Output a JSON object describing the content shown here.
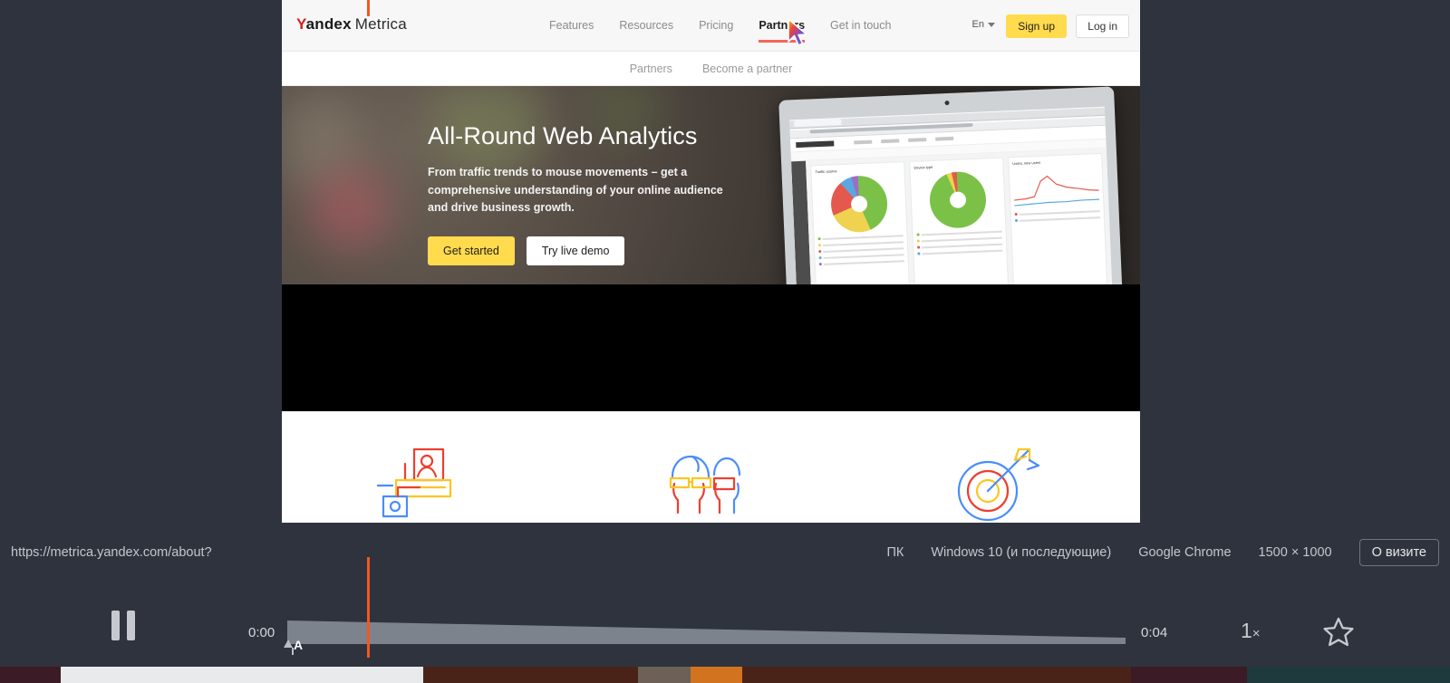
{
  "site": {
    "brand": {
      "y": "Y",
      "andex": "andex",
      "metrica": "Metrica"
    },
    "nav": [
      {
        "label": "Features",
        "active": false
      },
      {
        "label": "Resources",
        "active": false
      },
      {
        "label": "Pricing",
        "active": false
      },
      {
        "label": "Partners",
        "active": true
      },
      {
        "label": "Get in touch",
        "active": false
      }
    ],
    "lang": "En",
    "signup_label": "Sign up",
    "login_label": "Log in",
    "subnav": [
      {
        "label": "Partners"
      },
      {
        "label": "Become a partner"
      }
    ],
    "hero": {
      "title": "All-Round Web Analytics",
      "subtitle": "From traffic trends to mouse movements – get a comprehensive understanding of your online audience and drive business growth.",
      "primary_btn": "Get started",
      "secondary_btn": "Try live demo"
    },
    "dashboard": {
      "cards": [
        {
          "title": "Traffic source"
        },
        {
          "title": "Device type"
        },
        {
          "title": "Users, new users"
        }
      ]
    },
    "features": [
      {
        "icon": "profile-card-icon"
      },
      {
        "icon": "people-sunglasses-icon"
      },
      {
        "icon": "target-arrow-icon"
      }
    ]
  },
  "infobar": {
    "url": "https://metrica.yandex.com/about?",
    "device": "ПК",
    "os": "Windows 10 (и последующие)",
    "browser": "Google Chrome",
    "resolution": "1500 × 1000",
    "about_button": "О визите"
  },
  "player": {
    "state": "playing",
    "pause_label": "pause",
    "current_time": "0:00",
    "total_time": "0:04",
    "speed": "1",
    "speed_suffix": "×",
    "marker_label": "A",
    "playhead_percent": 9.5,
    "favorite": false
  },
  "colors": {
    "accent_yellow": "#ffdb4d",
    "brand_red": "#d91d1d",
    "playhead_orange": "#f25822",
    "chrome_bg": "#2f333d",
    "active_underline": "#f4665a"
  },
  "thumbstrip": [
    {
      "color": "#3b1b25",
      "width": 4.2
    },
    {
      "color": "#e9eaec",
      "width": 25.0
    },
    {
      "color": "#4a2318",
      "width": 14.8
    },
    {
      "color": "#6d6157",
      "width": 3.6
    },
    {
      "color": "#d2741f",
      "width": 3.6
    },
    {
      "color": "#4a2318",
      "width": 26.8
    },
    {
      "color": "#3b1b25",
      "width": 8.0
    },
    {
      "color": "#1f3a3c",
      "width": 14.0
    }
  ]
}
